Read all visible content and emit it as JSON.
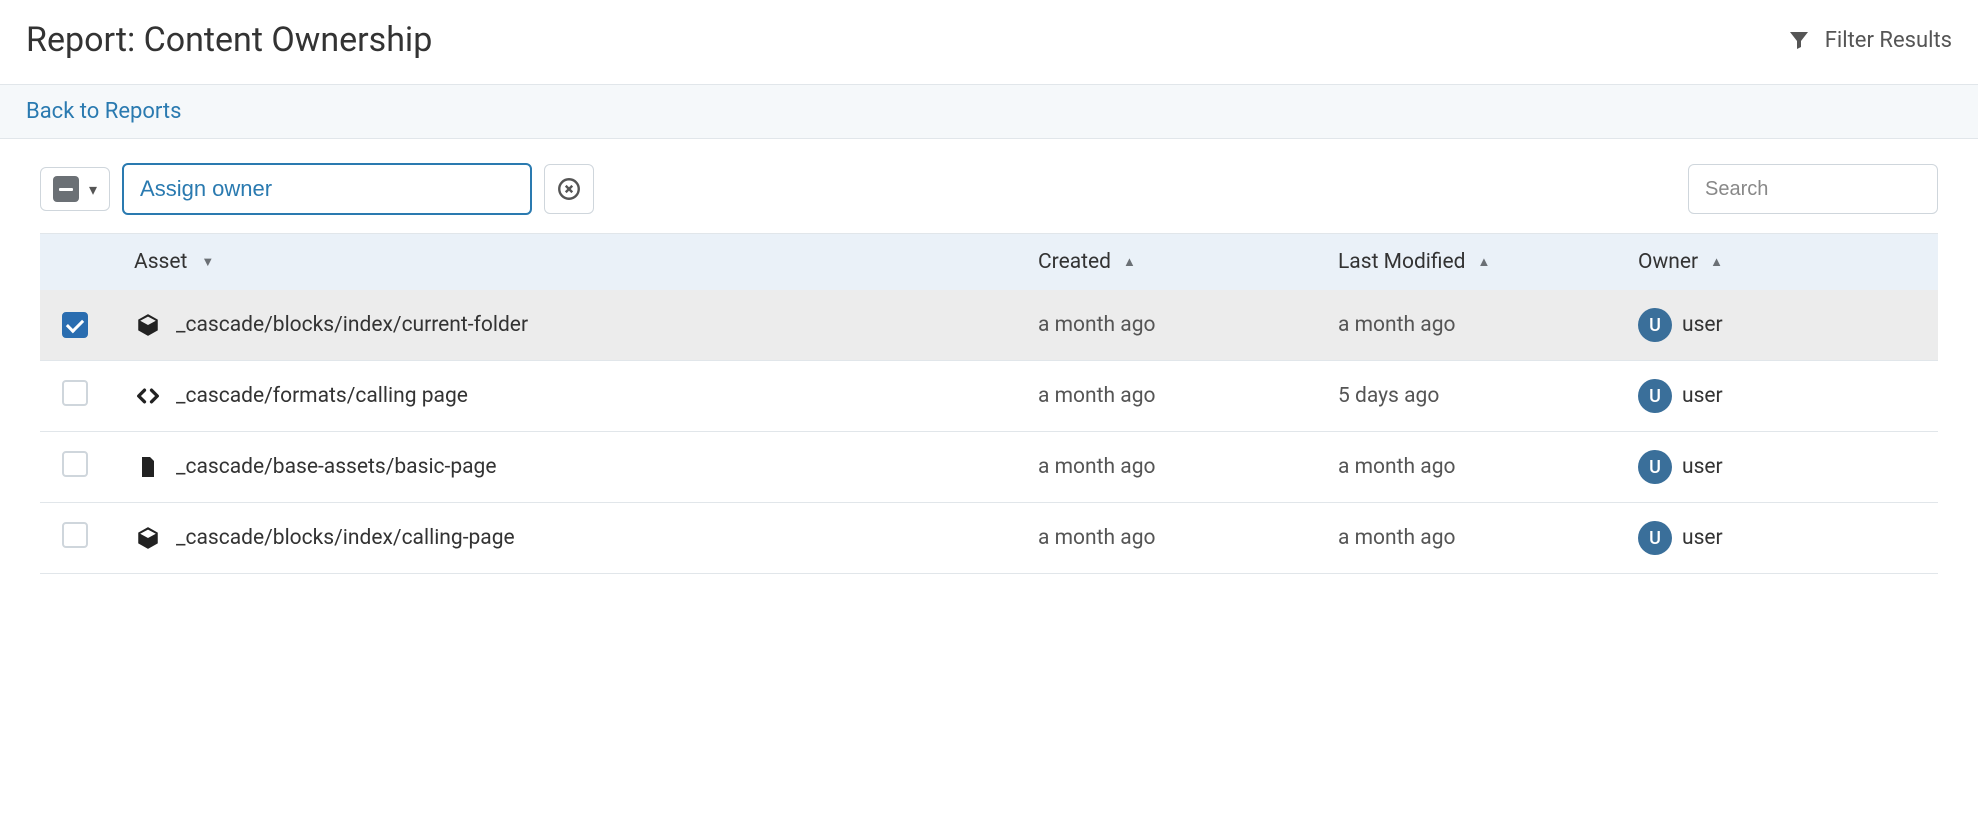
{
  "header": {
    "title": "Report: Content Ownership",
    "filter_label": "Filter Results"
  },
  "nav": {
    "back_label": "Back to Reports"
  },
  "toolbar": {
    "assign_placeholder": "Assign owner",
    "search_placeholder": "Search"
  },
  "columns": {
    "asset": "Asset",
    "created": "Created",
    "modified": "Last Modified",
    "owner": "Owner"
  },
  "owner_default": {
    "initial": "U",
    "name": "user"
  },
  "rows": [
    {
      "checked": true,
      "icon": "block",
      "asset": "_cascade/blocks/index/current-folder",
      "created": "a month ago",
      "modified": "a month ago",
      "owner_initial": "U",
      "owner_name": "user"
    },
    {
      "checked": false,
      "icon": "code",
      "asset": "_cascade/formats/calling page",
      "created": "a month ago",
      "modified": "5 days ago",
      "owner_initial": "U",
      "owner_name": "user"
    },
    {
      "checked": false,
      "icon": "page",
      "asset": "_cascade/base-assets/basic-page",
      "created": "a month ago",
      "modified": "a month ago",
      "owner_initial": "U",
      "owner_name": "user"
    },
    {
      "checked": false,
      "icon": "block",
      "asset": "_cascade/blocks/index/calling-page",
      "created": "a month ago",
      "modified": "a month ago",
      "owner_initial": "U",
      "owner_name": "user"
    }
  ]
}
